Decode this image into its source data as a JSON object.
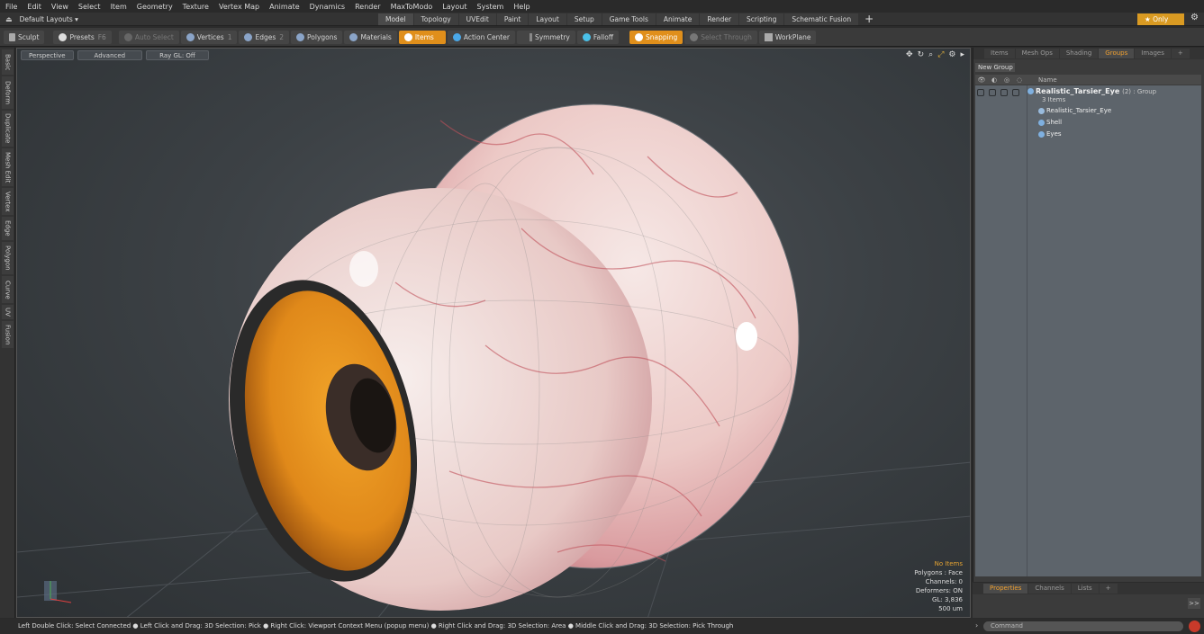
{
  "menu": [
    "File",
    "Edit",
    "View",
    "Select",
    "Item",
    "Geometry",
    "Texture",
    "Vertex Map",
    "Animate",
    "Dynamics",
    "Render",
    "MaxToModo",
    "Layout",
    "System",
    "Help"
  ],
  "layouts": {
    "preset": "Default Layouts ▾",
    "tabs": [
      "Model",
      "Topology",
      "UVEdit",
      "Paint",
      "Layout",
      "Setup",
      "Game Tools",
      "Animate",
      "Render",
      "Scripting",
      "Schematic Fusion"
    ],
    "active_tab": "Model",
    "plus": "+",
    "only_label": "★  Only",
    "gear": "⚙"
  },
  "toolbar": {
    "sculpt": "Sculpt",
    "presets": "Presets",
    "presets_key": "F6",
    "auto_select": "Auto Select",
    "vertices": "Vertices",
    "vertices_count": "1",
    "edges": "Edges",
    "edges_count": "2",
    "polygons": "Polygons",
    "materials": "Materials",
    "items": "Items",
    "action_center": "Action Center",
    "symmetry": "Symmetry",
    "falloff": "Falloff",
    "snapping": "Snapping",
    "select_through": "Select Through",
    "workplane": "WorkPlane"
  },
  "left_tabs": [
    "Basic",
    "Deform",
    "Duplicate",
    "Mesh Edit",
    "Vertex",
    "Edge",
    "Polygon",
    "Curve",
    "UV",
    "Fusion"
  ],
  "viewport": {
    "view_mode": "Perspective",
    "shading": "Advanced",
    "raygl": "Ray GL: Off",
    "info": {
      "no_items": "No Items",
      "polygons": "Polygons : Face",
      "channels": "Channels: 0",
      "deformers": "Deformers: ON",
      "gl": "GL: 3,836",
      "scale": "500 um"
    }
  },
  "right_panel": {
    "tabs": [
      "Items",
      "Mesh Ops",
      "Shading",
      "Groups",
      "Images",
      "+"
    ],
    "active_tab": "Groups",
    "new_group": "New Group",
    "name_header": "Name",
    "group": {
      "name": "Realistic_Tarsier_Eye",
      "suffix": "(2) : Group",
      "items_count": "3 Items",
      "children": [
        "Realistic_Tarsier_Eye",
        "Shell",
        "Eyes"
      ]
    },
    "bottom_tabs": [
      "Properties",
      "Channels",
      "Lists",
      "+"
    ],
    "bottom_active": "Properties",
    "expand": ">>"
  },
  "status": {
    "hint": "Left Double Click: Select Connected ● Left Click and Drag: 3D Selection: Pick ● Right Click: Viewport Context Menu (popup menu) ● Right Click and Drag: 3D Selection: Area ● Middle Click and Drag: 3D Selection: Pick Through",
    "command_placeholder": "Command"
  },
  "colors": {
    "accent": "#e08f1b",
    "iris": "#e89a1e",
    "sclera": "#efd8d6"
  }
}
